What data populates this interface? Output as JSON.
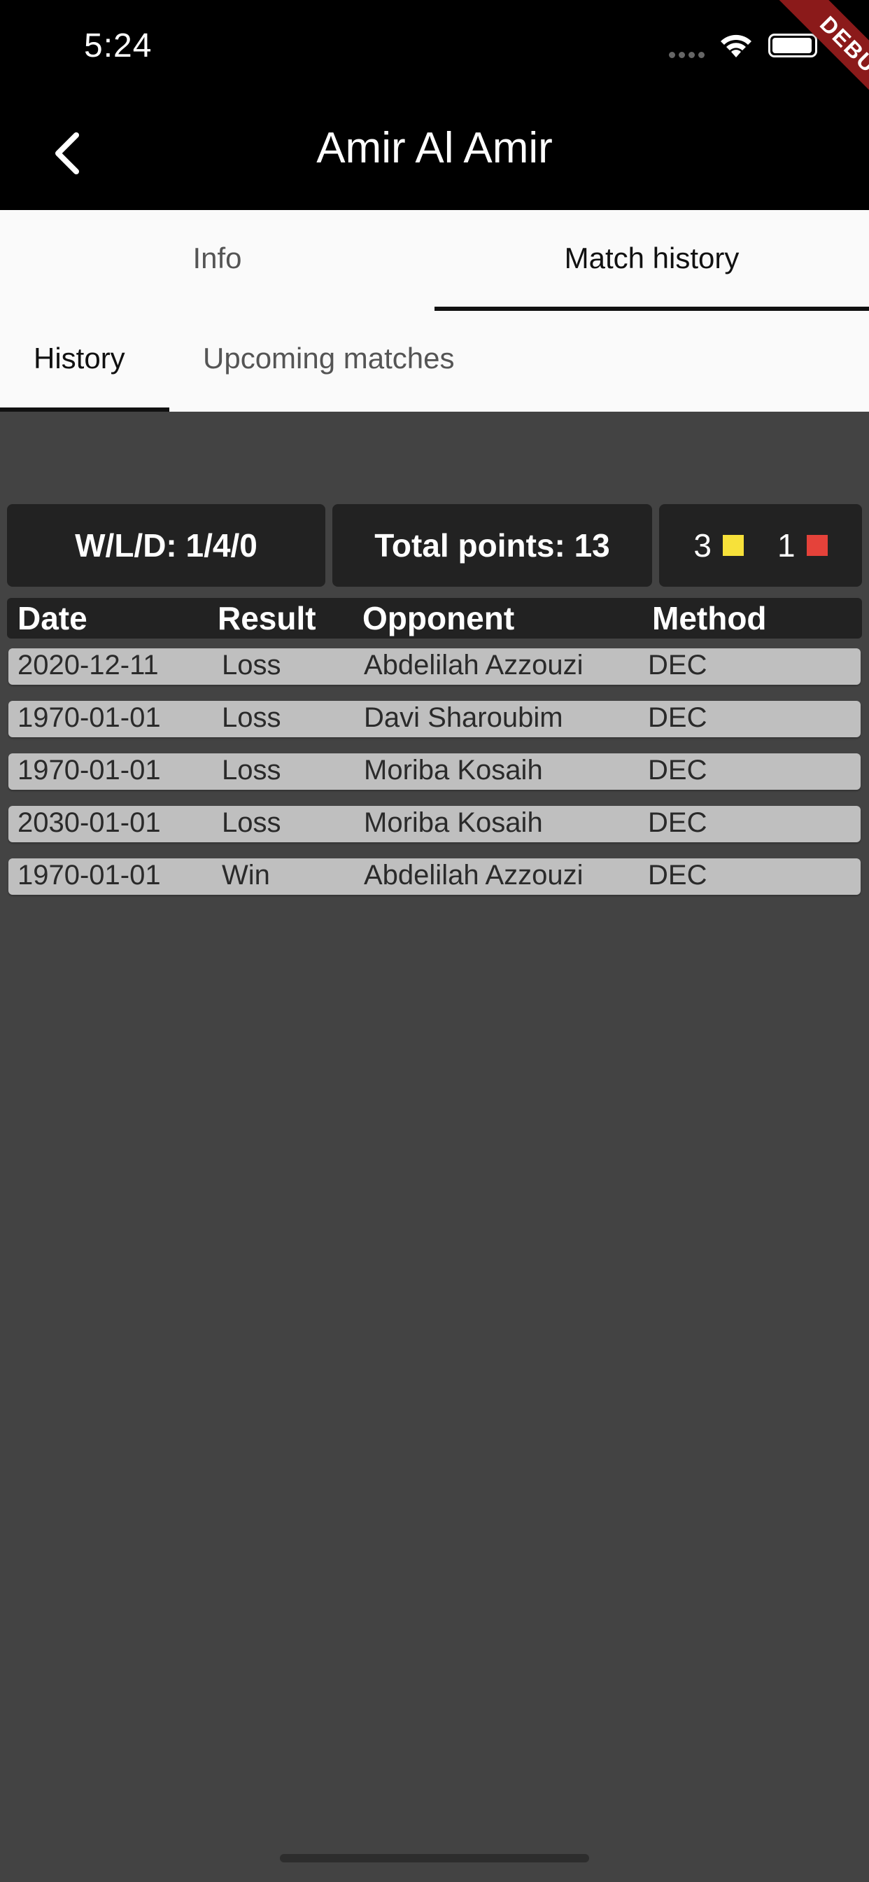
{
  "status_bar": {
    "time": "5:24"
  },
  "debug_banner": {
    "label": "DEBUG"
  },
  "app_bar": {
    "title": "Amir Al Amir"
  },
  "top_tabs": [
    {
      "label": "Info",
      "active": false
    },
    {
      "label": "Match history",
      "active": true
    }
  ],
  "sub_tabs": [
    {
      "label": "History",
      "active": true
    },
    {
      "label": "Upcoming matches",
      "active": false
    }
  ],
  "stats": {
    "wld": "W/L/D: 1/4/0",
    "total_points": "Total points: 13",
    "yellow_cards": "3",
    "red_cards": "1"
  },
  "colors": {
    "yellow_card": "#f7e13a",
    "red_card": "#e5423a"
  },
  "table": {
    "headers": {
      "date": "Date",
      "result": "Result",
      "opponent": "Opponent",
      "method": "Method"
    },
    "rows": [
      {
        "date": "2020-12-11",
        "result": "Loss",
        "opponent": "Abdelilah Azzouzi",
        "method": "DEC"
      },
      {
        "date": "1970-01-01",
        "result": "Loss",
        "opponent": "Davi Sharoubim",
        "method": "DEC"
      },
      {
        "date": "1970-01-01",
        "result": "Loss",
        "opponent": "Moriba Kosaih",
        "method": "DEC"
      },
      {
        "date": "2030-01-01",
        "result": "Loss",
        "opponent": "Moriba Kosaih",
        "method": "DEC"
      },
      {
        "date": "1970-01-01",
        "result": "Win",
        "opponent": "Abdelilah Azzouzi",
        "method": "DEC"
      }
    ]
  }
}
